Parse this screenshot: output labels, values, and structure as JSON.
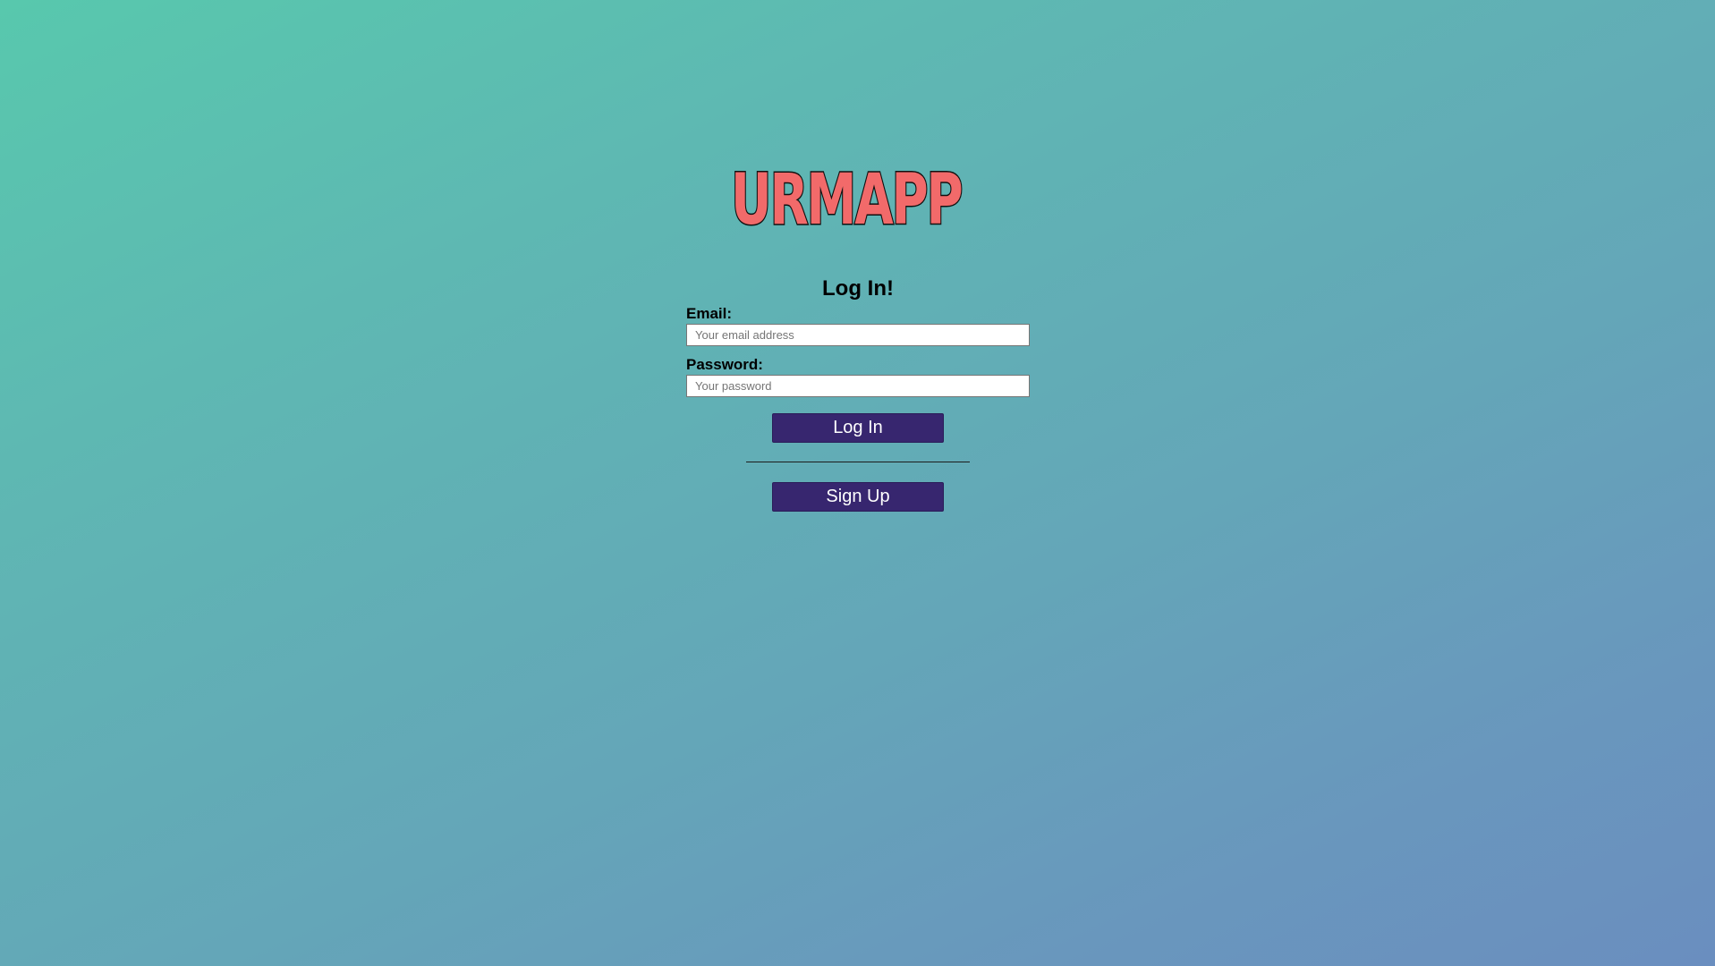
{
  "logo": {
    "wordmark": "URMAPP",
    "icon": "map-pin-icon",
    "colors": {
      "brand": "#f26a6a",
      "map_fill": "#4fc9a6",
      "road": "#6f72b8",
      "pin_yellow": "#f7e37a",
      "pin_red": "#f26a6a"
    }
  },
  "form": {
    "title": "Log In!",
    "email_label": "Email:",
    "email_placeholder": "Your email address",
    "email_value": "",
    "password_label": "Password:",
    "password_placeholder": "Your password",
    "password_value": "",
    "login_button": "Log In",
    "signup_button": "Sign Up"
  },
  "colors": {
    "button_bg": "#37266f",
    "button_text": "#ffffff",
    "background_start": "#58c8ad",
    "background_end": "#6a8ebf"
  }
}
